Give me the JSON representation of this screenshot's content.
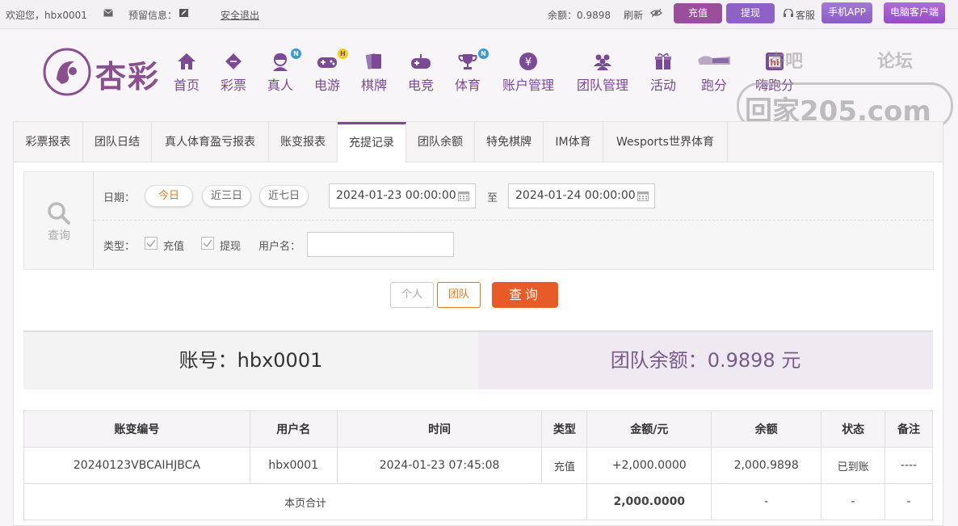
{
  "topbar": {
    "welcome": "欢迎您，hbx0001",
    "reserved_info": "预留信息：",
    "logout": "安全退出",
    "balance_label": "余额：",
    "balance_value": "0.9898",
    "refresh": "刷新",
    "deposit_button": "充值",
    "withdraw_button": "提现",
    "service": "客服",
    "mobile_app": "手机APP",
    "pc_client": "电脑客户端"
  },
  "header": {
    "logo_text": "杏彩",
    "nav": [
      {
        "label": "首页",
        "icon": "home-icon"
      },
      {
        "label": "彩票",
        "icon": "lottery-icon"
      },
      {
        "label": "真人",
        "icon": "live-dealer-icon",
        "badge": "N"
      },
      {
        "label": "电游",
        "icon": "gamepad-icon",
        "badge": "H"
      },
      {
        "label": "棋牌",
        "icon": "cards-icon"
      },
      {
        "label": "电竞",
        "icon": "esports-icon"
      },
      {
        "label": "体育",
        "icon": "trophy-icon",
        "badge": "N"
      },
      {
        "label": "账户管理",
        "icon": "account-icon"
      },
      {
        "label": "团队管理",
        "icon": "team-icon"
      },
      {
        "label": "活动",
        "icon": "gift-icon"
      },
      {
        "label": "跑分",
        "icon": "run-score-icon"
      },
      {
        "label": "嗨跑分",
        "icon": "hi-run-score-icon"
      }
    ],
    "watermark_lines": [
      "杏吧",
      "论坛",
      "回家205.com"
    ]
  },
  "tabs": [
    "彩票报表",
    "团队日结",
    "真人体育盈亏报表",
    "账变报表",
    "充提记录",
    "团队余额",
    "特免棋牌",
    "IM体育",
    "Wesports世界体育"
  ],
  "active_tab": "充提记录",
  "search": {
    "query_label": "查询",
    "date_label": "日期：",
    "quick_ranges": [
      "今日",
      "近三日",
      "近七日"
    ],
    "start_date": "2024-01-23 00:00:00",
    "to_label": "至",
    "end_date": "2024-01-24 00:00:00",
    "type_label": "类型：",
    "type_options": [
      "充值",
      "提现"
    ],
    "username_label": "用户名：",
    "username_value": ""
  },
  "actions": {
    "personal": "个人",
    "team": "团队",
    "query": "查询"
  },
  "summary": {
    "account_label": "账号：",
    "account_value": "hbx0001",
    "team_balance_label": "团队余额：",
    "team_balance_value": "0.9898",
    "team_balance_unit": "元"
  },
  "table": {
    "headers": [
      "账变编号",
      "用户名",
      "时间",
      "类型",
      "金额/元",
      "余额",
      "状态",
      "备注"
    ],
    "rows": [
      {
        "id": "20240123VBCAIHJBCA",
        "user": "hbx0001",
        "time": "2024-01-23 07:45:08",
        "type": "充值",
        "amount": "+2,000.0000",
        "balance": "2,000.9898",
        "status": "已到账",
        "note": "----"
      }
    ],
    "total": {
      "label": "本页合计",
      "amount": "2,000.0000",
      "balance": "-",
      "status": "-",
      "note": "-"
    }
  },
  "colors": {
    "brand": "#7a4a94",
    "accent": "#e85a28",
    "positive": "#3d9a2b"
  }
}
